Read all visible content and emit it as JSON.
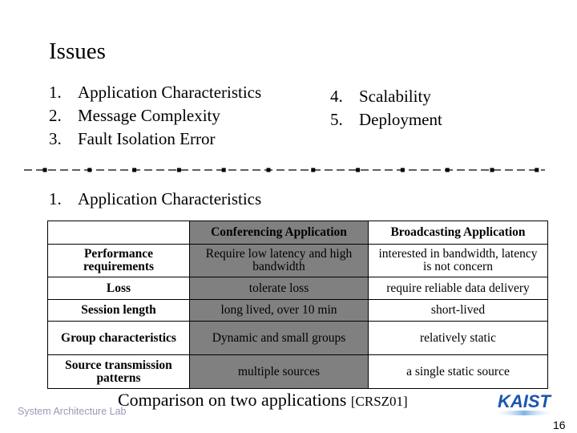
{
  "slide": {
    "title": "Issues",
    "issues_left": [
      {
        "num": "1.",
        "label": "Application Characteristics"
      },
      {
        "num": "2.",
        "label": "Message Complexity"
      },
      {
        "num": "3.",
        "label": "Fault Isolation Error"
      }
    ],
    "issues_right": [
      {
        "num": "4.",
        "label": "Scalability"
      },
      {
        "num": "5.",
        "label": "Deployment"
      }
    ],
    "section": {
      "num": "1.",
      "label": "Application Characteristics"
    },
    "table": {
      "headers": [
        "",
        "Conferencing Application",
        "Broadcasting Application"
      ],
      "rows": [
        {
          "label": "Performance requirements",
          "conferencing": "Require low latency and high bandwidth",
          "broadcasting": "interested in bandwidth, latency is not concern"
        },
        {
          "label": "Loss",
          "conferencing": "tolerate loss",
          "broadcasting": "require reliable data delivery"
        },
        {
          "label": "Session length",
          "conferencing": "long lived, over 10 min",
          "broadcasting": "short-lived"
        },
        {
          "label": "Group characteristics",
          "conferencing": "Dynamic and small groups",
          "broadcasting": "relatively static"
        },
        {
          "label": "Source transmission patterns",
          "conferencing": "multiple sources",
          "broadcasting": "a single static source"
        }
      ]
    },
    "caption": "Comparison on two applications",
    "citation": "[CRSZ01]",
    "footer_lab": "System Architecture Lab",
    "logo_text": "KAIST",
    "page_number": "16",
    "colors": {
      "conferencing_column": "#808080",
      "logo_blue": "#1a56b0",
      "lab_text": "#9a98b8"
    }
  }
}
